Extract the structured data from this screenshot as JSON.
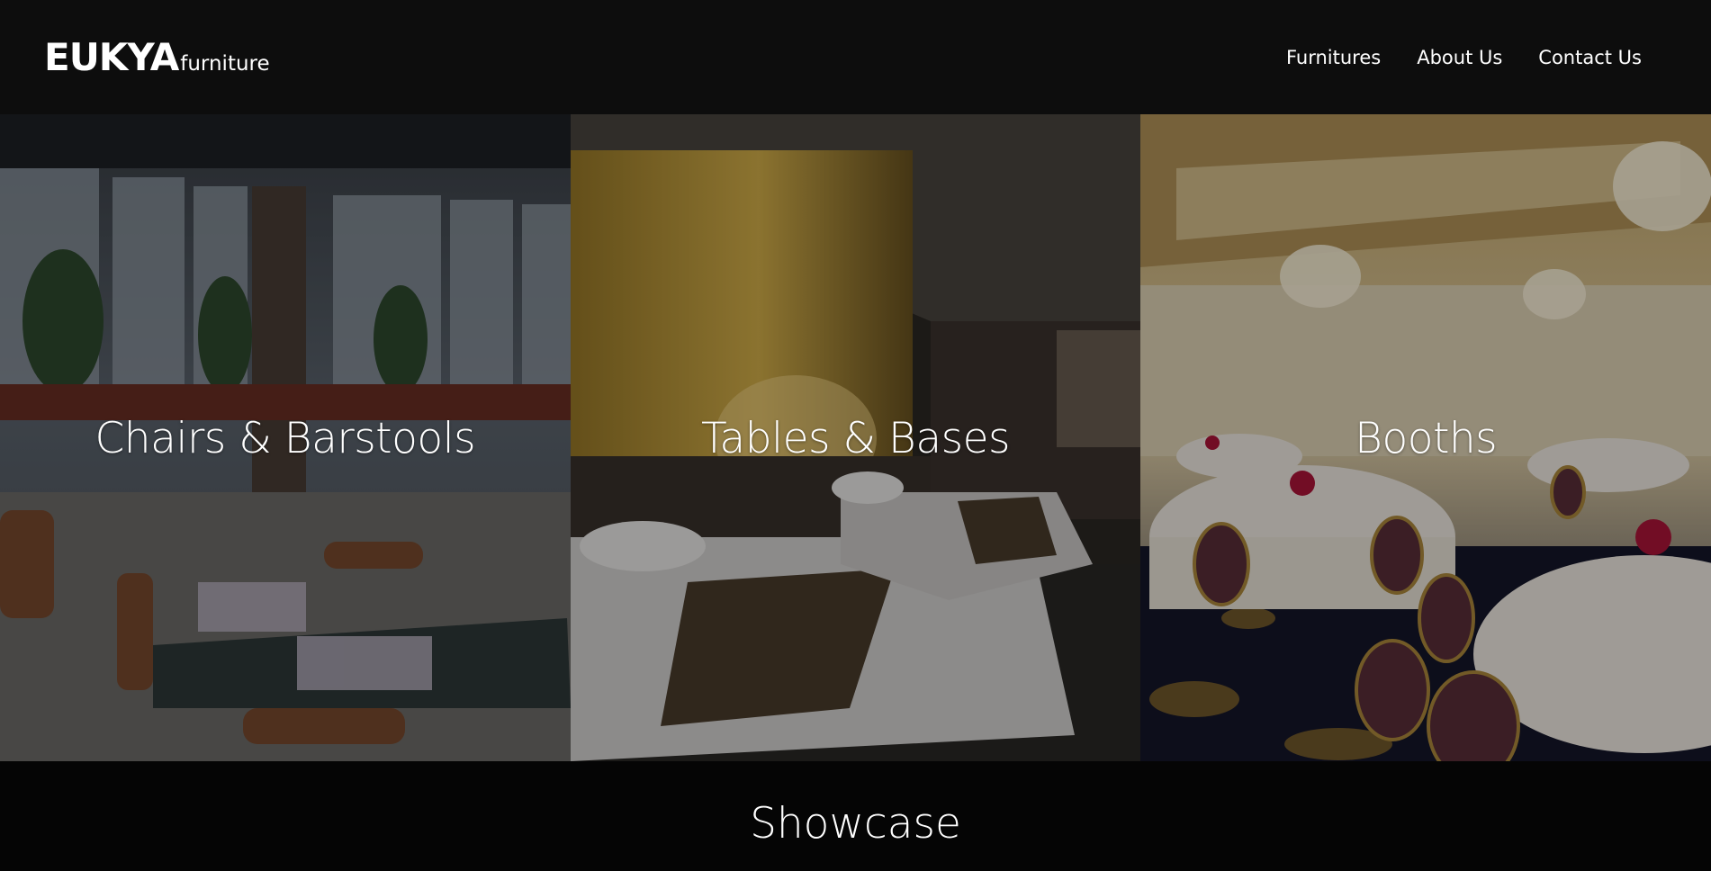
{
  "brand": {
    "name": "EUKYA",
    "sub": "furniture"
  },
  "nav": {
    "items": [
      {
        "label": "Furnitures"
      },
      {
        "label": "About Us"
      },
      {
        "label": "Contact Us"
      }
    ]
  },
  "panels": [
    {
      "label": "Chairs & Barstools",
      "scene": "restaurant-interior"
    },
    {
      "label": "Tables & Bases",
      "scene": "hotel-bedroom"
    },
    {
      "label": "Booths",
      "scene": "banquet-hall"
    }
  ],
  "showcase": {
    "title": "Showcase"
  },
  "colors": {
    "header_bg": "#0d0d0d",
    "page_bg": "#000000",
    "text": "#ffffff"
  }
}
